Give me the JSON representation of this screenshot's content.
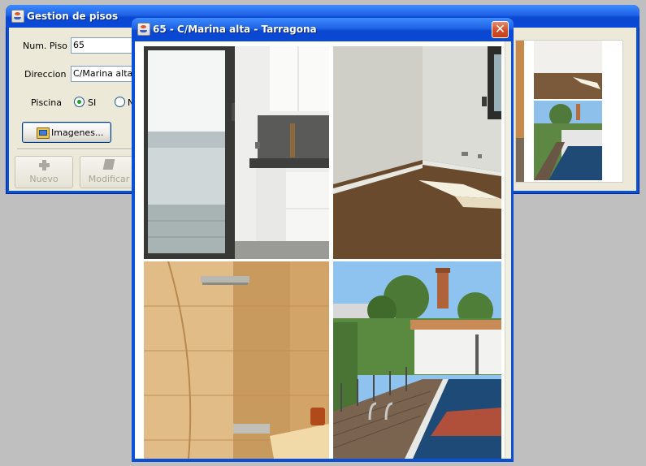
{
  "main_window": {
    "title": "Gestion de pisos",
    "form": {
      "num_piso_label": "Num. Piso",
      "num_piso_value": "65",
      "direccion_label": "Direccion",
      "direccion_value": "C/Marina alta",
      "piscina_label": "Piscina",
      "piscina_options": [
        {
          "label": "SI",
          "selected": true
        },
        {
          "label": "N",
          "selected": false
        }
      ]
    },
    "images_button": "Imagenes...",
    "toolbar": [
      {
        "label": "Nuevo",
        "icon": "plus-icon",
        "enabled": false
      },
      {
        "label": "Modificar",
        "icon": "edit-icon",
        "enabled": false
      }
    ]
  },
  "dialog": {
    "title": "65 - C/Marina alta - Tarragona",
    "close_glyph": "✕",
    "photos": [
      {
        "name": "kitchen-balcony-photo"
      },
      {
        "name": "empty-room-photo"
      },
      {
        "name": "bathroom-photo"
      },
      {
        "name": "pool-terrace-photo"
      }
    ]
  },
  "colors": {
    "titlebar": "#0a4fd8",
    "window_body": "#ece9d8",
    "desktop": "#bfbfbf",
    "close_button": "#d8502b"
  }
}
